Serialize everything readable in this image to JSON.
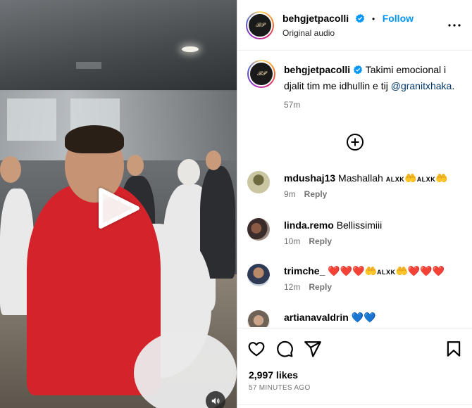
{
  "post": {
    "author": "behgjetpacolli",
    "follow_label": "Follow",
    "separator": "•",
    "audio": "Original audio",
    "avatar_text": "Behgjet Pacolli"
  },
  "caption": {
    "username": "behgjetpacolli",
    "text": "Takimi emocional i djalit tim me idhullin e tij",
    "mention": "@granitxhaka",
    "trailing": ".",
    "age": "57m"
  },
  "comments": [
    {
      "username": "mdushaj13",
      "parts": [
        {
          "kind": "text",
          "value": "Mashallah"
        },
        {
          "kind": "tag",
          "value": "ALXK"
        },
        {
          "kind": "hands",
          "value": "🤲"
        },
        {
          "kind": "tag",
          "value": "ALXK"
        },
        {
          "kind": "hands",
          "value": "🤲"
        }
      ],
      "age": "9m",
      "reply_label": "Reply"
    },
    {
      "username": "linda.remo",
      "parts": [
        {
          "kind": "text",
          "value": "Bellissimiii"
        }
      ],
      "age": "10m",
      "reply_label": "Reply"
    },
    {
      "username": "trimche_",
      "parts": [
        {
          "kind": "red",
          "value": "❤️❤️❤️"
        },
        {
          "kind": "hands",
          "value": "🤲"
        },
        {
          "kind": "tag",
          "value": "ALXK"
        },
        {
          "kind": "hands",
          "value": "🤲"
        },
        {
          "kind": "red",
          "value": "❤️❤️❤️"
        }
      ],
      "age": "12m",
      "reply_label": "Reply"
    },
    {
      "username": "artianavaldrin",
      "parts": [
        {
          "kind": "blue",
          "value": "💙💙"
        }
      ],
      "age": "",
      "reply_label": ""
    }
  ],
  "actions": {
    "likes": "2,997 likes",
    "posted": "57 MINUTES AGO"
  },
  "icons": {
    "like": "heart-icon",
    "comment": "comment-icon",
    "share": "share-icon",
    "save": "bookmark-icon",
    "more": "more-options-icon",
    "play": "play-icon",
    "audio": "speaker-icon",
    "load_more": "plus-circle-icon",
    "verified": "verified-badge-icon"
  },
  "colors": {
    "link_blue": "#0095f6",
    "mention_blue": "#00376b",
    "verified_blue": "#0095f6",
    "secondary_text": "#737373"
  }
}
